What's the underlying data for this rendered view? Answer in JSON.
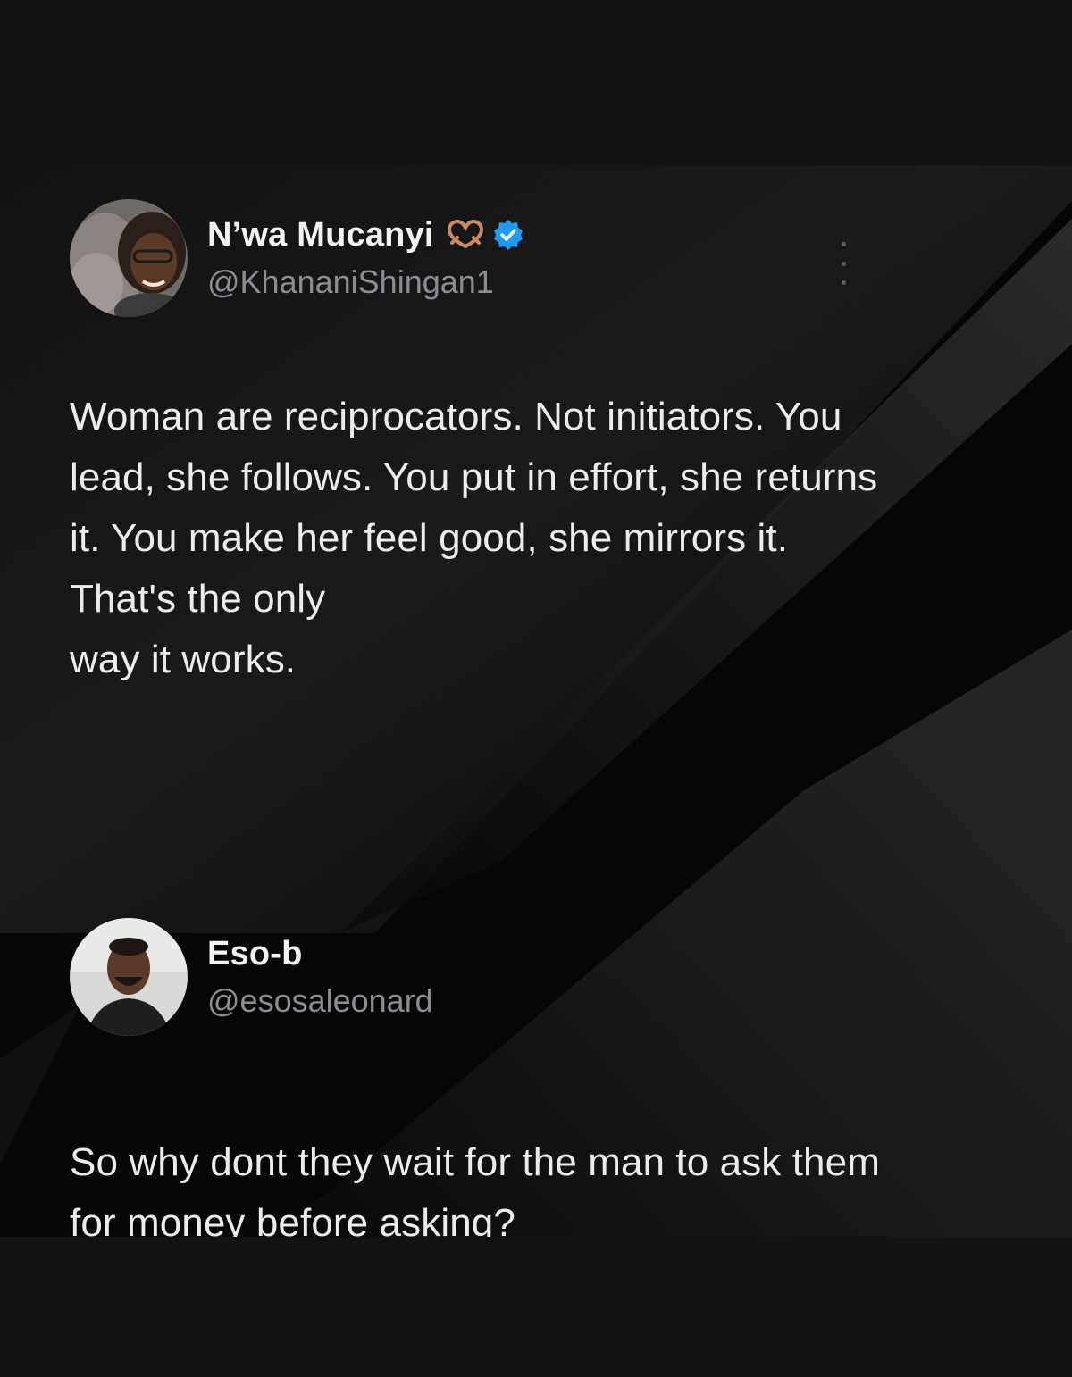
{
  "tweet": {
    "author_name": "N’wa Mucanyi",
    "author_handle": "@KhananiShingan1",
    "emoji_icon": "heart-hands-icon",
    "verified_icon": "verified-badge-icon",
    "verified_color": "#1d9bf0",
    "text_lines": [
      "Woman are reciprocators. Not initiators. You",
      "lead, she follows. You put in effort, she returns",
      "it. You make her feel good, she mirrors it.",
      "That's the only",
      "way it works."
    ]
  },
  "reply": {
    "author_name": "Eso-b",
    "author_handle": "@esosaleonard",
    "text_lines": [
      "So why dont they wait for the man to ask them",
      "for money before asking?"
    ]
  }
}
